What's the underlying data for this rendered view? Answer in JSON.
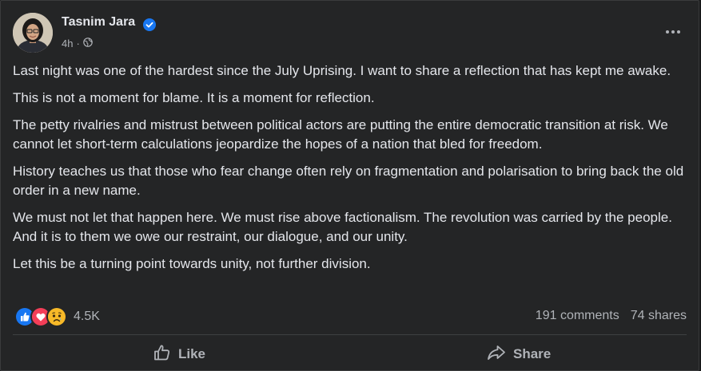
{
  "post": {
    "author": "Tasnim Jara",
    "time": "4h",
    "audience_icon": "globe-icon",
    "paragraphs": [
      "Last night was one of the hardest since the July Uprising. I want to share a reflection that has kept me awake.",
      "This is not a moment for blame. It is a moment for reflection.",
      "The petty rivalries and mistrust between political actors are putting the entire democratic transition at risk. We cannot let short-term calculations jeopardize the hopes of a nation that bled for freedom.",
      "History teaches us that those who fear change often rely on fragmentation and polarisation to bring back the old order in a new name.",
      "We must not let that happen here. We must rise above factionalism. The revolution was carried by the people. And it is to them we owe our restraint, our dialogue, and our unity.",
      "Let this be a turning point towards unity, not further division."
    ]
  },
  "reactions": {
    "icons": [
      "like-reaction-icon",
      "love-reaction-icon",
      "sad-reaction-icon"
    ],
    "count": "4.5K"
  },
  "stats": {
    "comments": "191 comments",
    "shares": "74 shares"
  },
  "actions": {
    "like": "Like",
    "share": "Share"
  },
  "colors": {
    "background": "#242526",
    "text": "#e4e6eb",
    "secondary_text": "#b0b3b8",
    "verified_blue": "#1877f2",
    "love_red": "#f33e58",
    "sad_yellow": "#f7b928"
  }
}
